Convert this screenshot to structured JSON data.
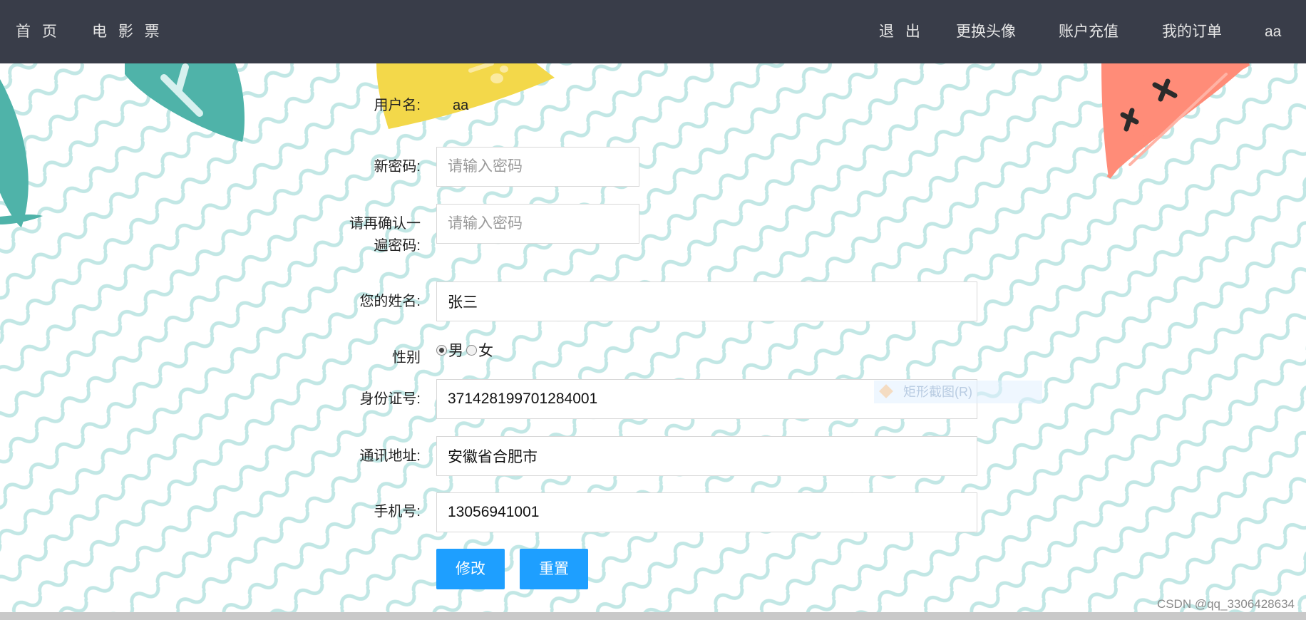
{
  "nav": {
    "home": "首 页",
    "movie_tickets": "电 影 票",
    "logout": "退 出",
    "change_avatar": "更换头像",
    "recharge": "账户充值",
    "my_orders": "我的订单",
    "username": "aa"
  },
  "form": {
    "username_label": "用户名:",
    "username_value": "aa",
    "new_password_label": "新密码:",
    "new_password_placeholder": "请输入密码",
    "confirm_password_label_line1": "请再确认一",
    "confirm_password_label_line2": "遍密码:",
    "confirm_password_placeholder": "请输入密码",
    "name_label": "您的姓名:",
    "name_value": "张三",
    "gender_label": "性别",
    "gender_options": [
      "男",
      "女"
    ],
    "gender_selected": "男",
    "id_label": "身份证号:",
    "id_value": "371428199701284001",
    "address_label": "通讯地址:",
    "address_value": "安徽省合肥市",
    "phone_label": "手机号:",
    "phone_value": "13056941001",
    "submit_label": "修改",
    "reset_label": "重置"
  },
  "overlay": {
    "screenshot_tip": "矩形截图(R)"
  },
  "watermark": "CSDN @qq_3306428634",
  "colors": {
    "navbar": "#393d49",
    "button": "#1e9fff",
    "wave": "#b7e3e0"
  }
}
